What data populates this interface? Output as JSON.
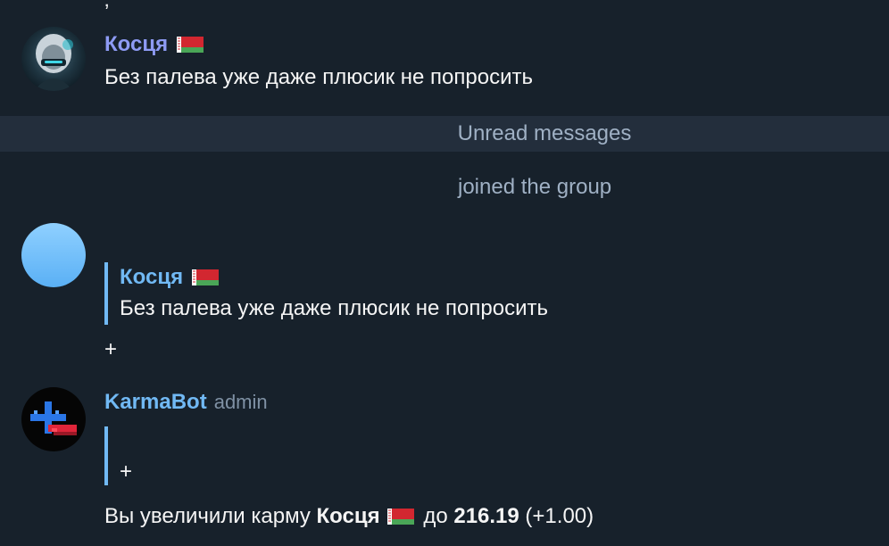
{
  "messages": [
    {
      "sender": "Косця",
      "text": "Без палева уже даже плюсик не попросить"
    }
  ],
  "unread_label": "Unread messages",
  "service_message": "joined the group",
  "reply_message": {
    "quoted_sender": "Косця",
    "quoted_text": "Без палева уже даже плюсик не попросить",
    "text": "+"
  },
  "bot_message": {
    "sender": "KarmaBot",
    "badge": "admin",
    "quoted_text": "+",
    "result_prefix": "Вы увеличили карму",
    "result_user": "Косця",
    "result_mid": "до",
    "result_value": "216.19",
    "result_delta": "(+1.00)"
  },
  "colors": {
    "background": "#17212b",
    "unread_bar": "#232e3c",
    "accent_name": "#71b9f4",
    "accent_name_alt": "#8e9bf4",
    "secondary_text": "#9fb0c4"
  },
  "icons": [
    "belarus-flag-icon",
    "user-avatar",
    "blank-avatar",
    "karmabot-avatar"
  ]
}
